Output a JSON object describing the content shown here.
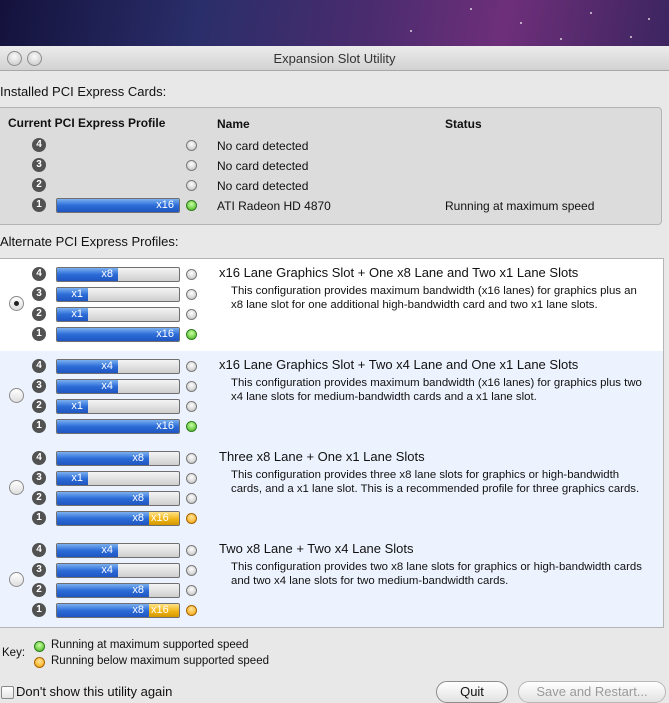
{
  "window": {
    "title": "Expansion Slot Utility"
  },
  "installed": {
    "section_label": "Installed PCI Express Cards:",
    "headers": {
      "profile": "Current PCI Express Profile",
      "name": "Name",
      "status": "Status"
    },
    "rows": [
      {
        "slot": "4",
        "bar_label": "",
        "bar_fill": 0,
        "indicator": "off",
        "name": "No card detected",
        "status": ""
      },
      {
        "slot": "3",
        "bar_label": "",
        "bar_fill": 0,
        "indicator": "off",
        "name": "No card detected",
        "status": ""
      },
      {
        "slot": "2",
        "bar_label": "",
        "bar_fill": 0,
        "indicator": "off",
        "name": "No card detected",
        "status": ""
      },
      {
        "slot": "1",
        "bar_label": "x16",
        "bar_fill": 1.0,
        "indicator": "green",
        "name": "ATI Radeon HD 4870",
        "status": "Running at maximum speed"
      }
    ]
  },
  "alternate": {
    "section_label": "Alternate PCI Express Profiles:",
    "profiles": [
      {
        "selected": true,
        "title": "x16 Lane Graphics Slot + One x8 Lane and Two x1 Lane Slots",
        "description": "This configuration provides maximum bandwidth (x16 lanes) for graphics plus an x8 lane slot for one additional high-bandwidth card and two x1 lane slots.",
        "slots": [
          {
            "slot": "4",
            "label": "x8",
            "fill": 0.5,
            "extra": "",
            "indicator": "off"
          },
          {
            "slot": "3",
            "label": "x1",
            "fill": 0.25,
            "extra": "",
            "indicator": "off"
          },
          {
            "slot": "2",
            "label": "x1",
            "fill": 0.25,
            "extra": "",
            "indicator": "off"
          },
          {
            "slot": "1",
            "label": "x16",
            "fill": 1.0,
            "extra": "",
            "indicator": "green"
          }
        ]
      },
      {
        "selected": false,
        "title": "x16 Lane Graphics Slot + Two x4 Lane and One x1 Lane Slots",
        "description": "This configuration provides maximum bandwidth (x16 lanes) for graphics plus two x4 lane slots for medium-bandwidth cards and a x1 lane slot.",
        "slots": [
          {
            "slot": "4",
            "label": "x4",
            "fill": 0.5,
            "extra": "",
            "indicator": "off"
          },
          {
            "slot": "3",
            "label": "x4",
            "fill": 0.5,
            "extra": "",
            "indicator": "off"
          },
          {
            "slot": "2",
            "label": "x1",
            "fill": 0.25,
            "extra": "",
            "indicator": "off"
          },
          {
            "slot": "1",
            "label": "x16",
            "fill": 1.0,
            "extra": "",
            "indicator": "green"
          }
        ]
      },
      {
        "selected": false,
        "title": "Three x8 Lane + One x1 Lane Slots",
        "description": "This configuration provides three x8 lane slots for graphics or high-bandwidth cards, and a x1 lane slot.  This is a recommended profile for three graphics cards.",
        "slots": [
          {
            "slot": "4",
            "label": "x8",
            "fill": 0.75,
            "extra": "",
            "indicator": "off"
          },
          {
            "slot": "3",
            "label": "x1",
            "fill": 0.25,
            "extra": "",
            "indicator": "off"
          },
          {
            "slot": "2",
            "label": "x8",
            "fill": 0.75,
            "extra": "",
            "indicator": "off"
          },
          {
            "slot": "1",
            "label": "x8",
            "fill": 0.75,
            "extra": "x16",
            "indicator": "orange"
          }
        ]
      },
      {
        "selected": false,
        "title": "Two x8 Lane + Two x4 Lane Slots",
        "description": "This configuration provides two x8 lane slots for graphics or high-bandwidth cards and two x4 lane slots for two medium-bandwidth cards.",
        "slots": [
          {
            "slot": "4",
            "label": "x4",
            "fill": 0.5,
            "extra": "",
            "indicator": "off"
          },
          {
            "slot": "3",
            "label": "x4",
            "fill": 0.5,
            "extra": "",
            "indicator": "off"
          },
          {
            "slot": "2",
            "label": "x8",
            "fill": 0.75,
            "extra": "",
            "indicator": "off"
          },
          {
            "slot": "1",
            "label": "x8",
            "fill": 0.75,
            "extra": "x16",
            "indicator": "orange"
          }
        ]
      }
    ]
  },
  "key": {
    "label": "Key:",
    "items": [
      {
        "indicator": "green",
        "text": "Running at maximum supported speed"
      },
      {
        "indicator": "orange",
        "text": "Running below maximum supported speed"
      }
    ]
  },
  "footer": {
    "dont_show_label": "Don't show this utility again",
    "quit_label": "Quit",
    "save_restart_label": "Save and Restart..."
  },
  "colors": {
    "lane_blue": "#2c6cd8",
    "lane_orange": "#f0b415",
    "selected_row_bg": "#ffffff",
    "alt_row_bg": "#edf3fe"
  }
}
